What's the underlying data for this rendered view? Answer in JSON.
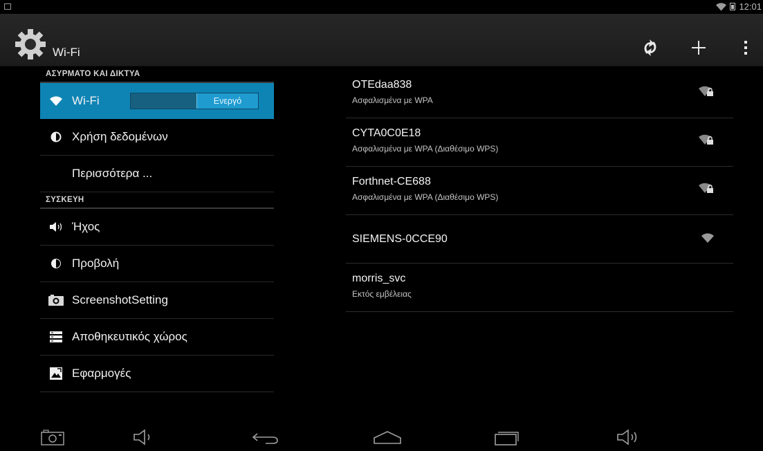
{
  "status_bar": {
    "time": "12:01"
  },
  "action_bar": {
    "title": "Wi-Fi"
  },
  "left_pane": {
    "sections": {
      "wireless": "ΑΣΥΡΜΑΤΟ ΚΑΙ ΔΙΚΤΥΑ",
      "device": "ΣΥΣΚΕΥΗ"
    },
    "items": {
      "wifi": "Wi-Fi",
      "wifi_toggle": "Ενεργό",
      "data_usage": "Χρήση δεδομένων",
      "more": "Περισσότερα ...",
      "sound": "Ήχος",
      "display": "Προβολή",
      "screenshot": "ScreenshotSetting",
      "storage": "Αποθηκευτικός χώρος",
      "apps": "Εφαρμογές"
    }
  },
  "networks": [
    {
      "ssid": "OTEdaa838",
      "status": "Ασφαλισμένα με WPA",
      "icon": "wifi-lock-icon"
    },
    {
      "ssid": "CYTA0C0E18",
      "status": "Ασφαλισμένα με WPA (Διαθέσιμο WPS)",
      "icon": "wifi-lock-icon"
    },
    {
      "ssid": "Forthnet-CE688",
      "status": "Ασφαλισμένα με WPA (Διαθέσιμο WPS)",
      "icon": "wifi-lock-icon"
    },
    {
      "ssid": "SIEMENS-0CCE90",
      "status": "",
      "icon": "wifi-icon"
    },
    {
      "ssid": "morris_svc",
      "status": "Εκτός εμβέλειας",
      "icon": ""
    }
  ],
  "colors": {
    "accent": "#0e84b5",
    "background": "#000000",
    "actionbar": "#222222"
  }
}
